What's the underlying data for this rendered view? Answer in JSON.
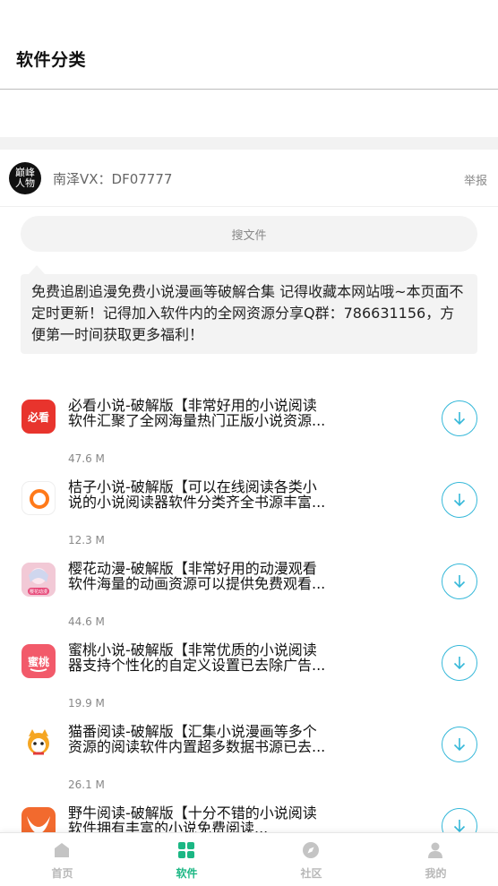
{
  "header": {
    "title": "软件分类"
  },
  "author": {
    "avatar_text": "巅峰人物",
    "name": "南泽VX：DF07777",
    "report_label": "举报"
  },
  "search": {
    "label": "搜文件"
  },
  "notice": {
    "text": "免费追剧追漫免费小说漫画等破解合集 记得收藏本网站哦~本页面不定时更新！记得加入软件内的全网资源分享Q群：786631156，方便第一时间获取更多福利！"
  },
  "apps": [
    {
      "title": "必看小说-破解版【非常好用的小说阅读软件汇聚了全网海量热门正版小说资源...",
      "size": "47.6 M",
      "icon": "bikan-icon",
      "icon_text": "必看",
      "color": "#e8342d"
    },
    {
      "title": "桔子小说-破解版【可以在线阅读各类小说的小说阅读器软件分类齐全书源丰富...",
      "size": "12.3 M",
      "icon": "juzi-icon",
      "icon_text": "",
      "color": "#ff7a1a"
    },
    {
      "title": "樱花动漫-破解版【非常好用的动漫观看软件海量的动画资源可以提供免费观看...",
      "size": "44.6 M",
      "icon": "yinghua-icon",
      "icon_text": "樱花动漫",
      "color": "#f07aa0"
    },
    {
      "title": "蜜桃小说-破解版【非常优质的小说阅读器支持个性化的自定义设置已去除广告...",
      "size": "19.9 M",
      "icon": "mitao-icon",
      "icon_text": "蜜桃",
      "color": "#f25a6a"
    },
    {
      "title": "猫番阅读-破解版【汇集小说漫画等多个资源的阅读软件内置超多数据书源已去...",
      "size": "26.1 M",
      "icon": "maofan-icon",
      "icon_text": "",
      "color": "#f5a623"
    },
    {
      "title": "野牛阅读-破解版【十分不错的小说阅读软件拥有丰富的小说免费阅读...",
      "size": "",
      "icon": "yeniu-icon",
      "icon_text": "",
      "color": "#f26a2e"
    }
  ],
  "tabbar": {
    "tabs": [
      {
        "label": "首页",
        "icon": "home-icon"
      },
      {
        "label": "软件",
        "icon": "apps-icon"
      },
      {
        "label": "社区",
        "icon": "compass-icon"
      },
      {
        "label": "我的",
        "icon": "user-icon"
      }
    ],
    "active_color": "#1bb784",
    "inactive_color": "#c4c4c4"
  }
}
